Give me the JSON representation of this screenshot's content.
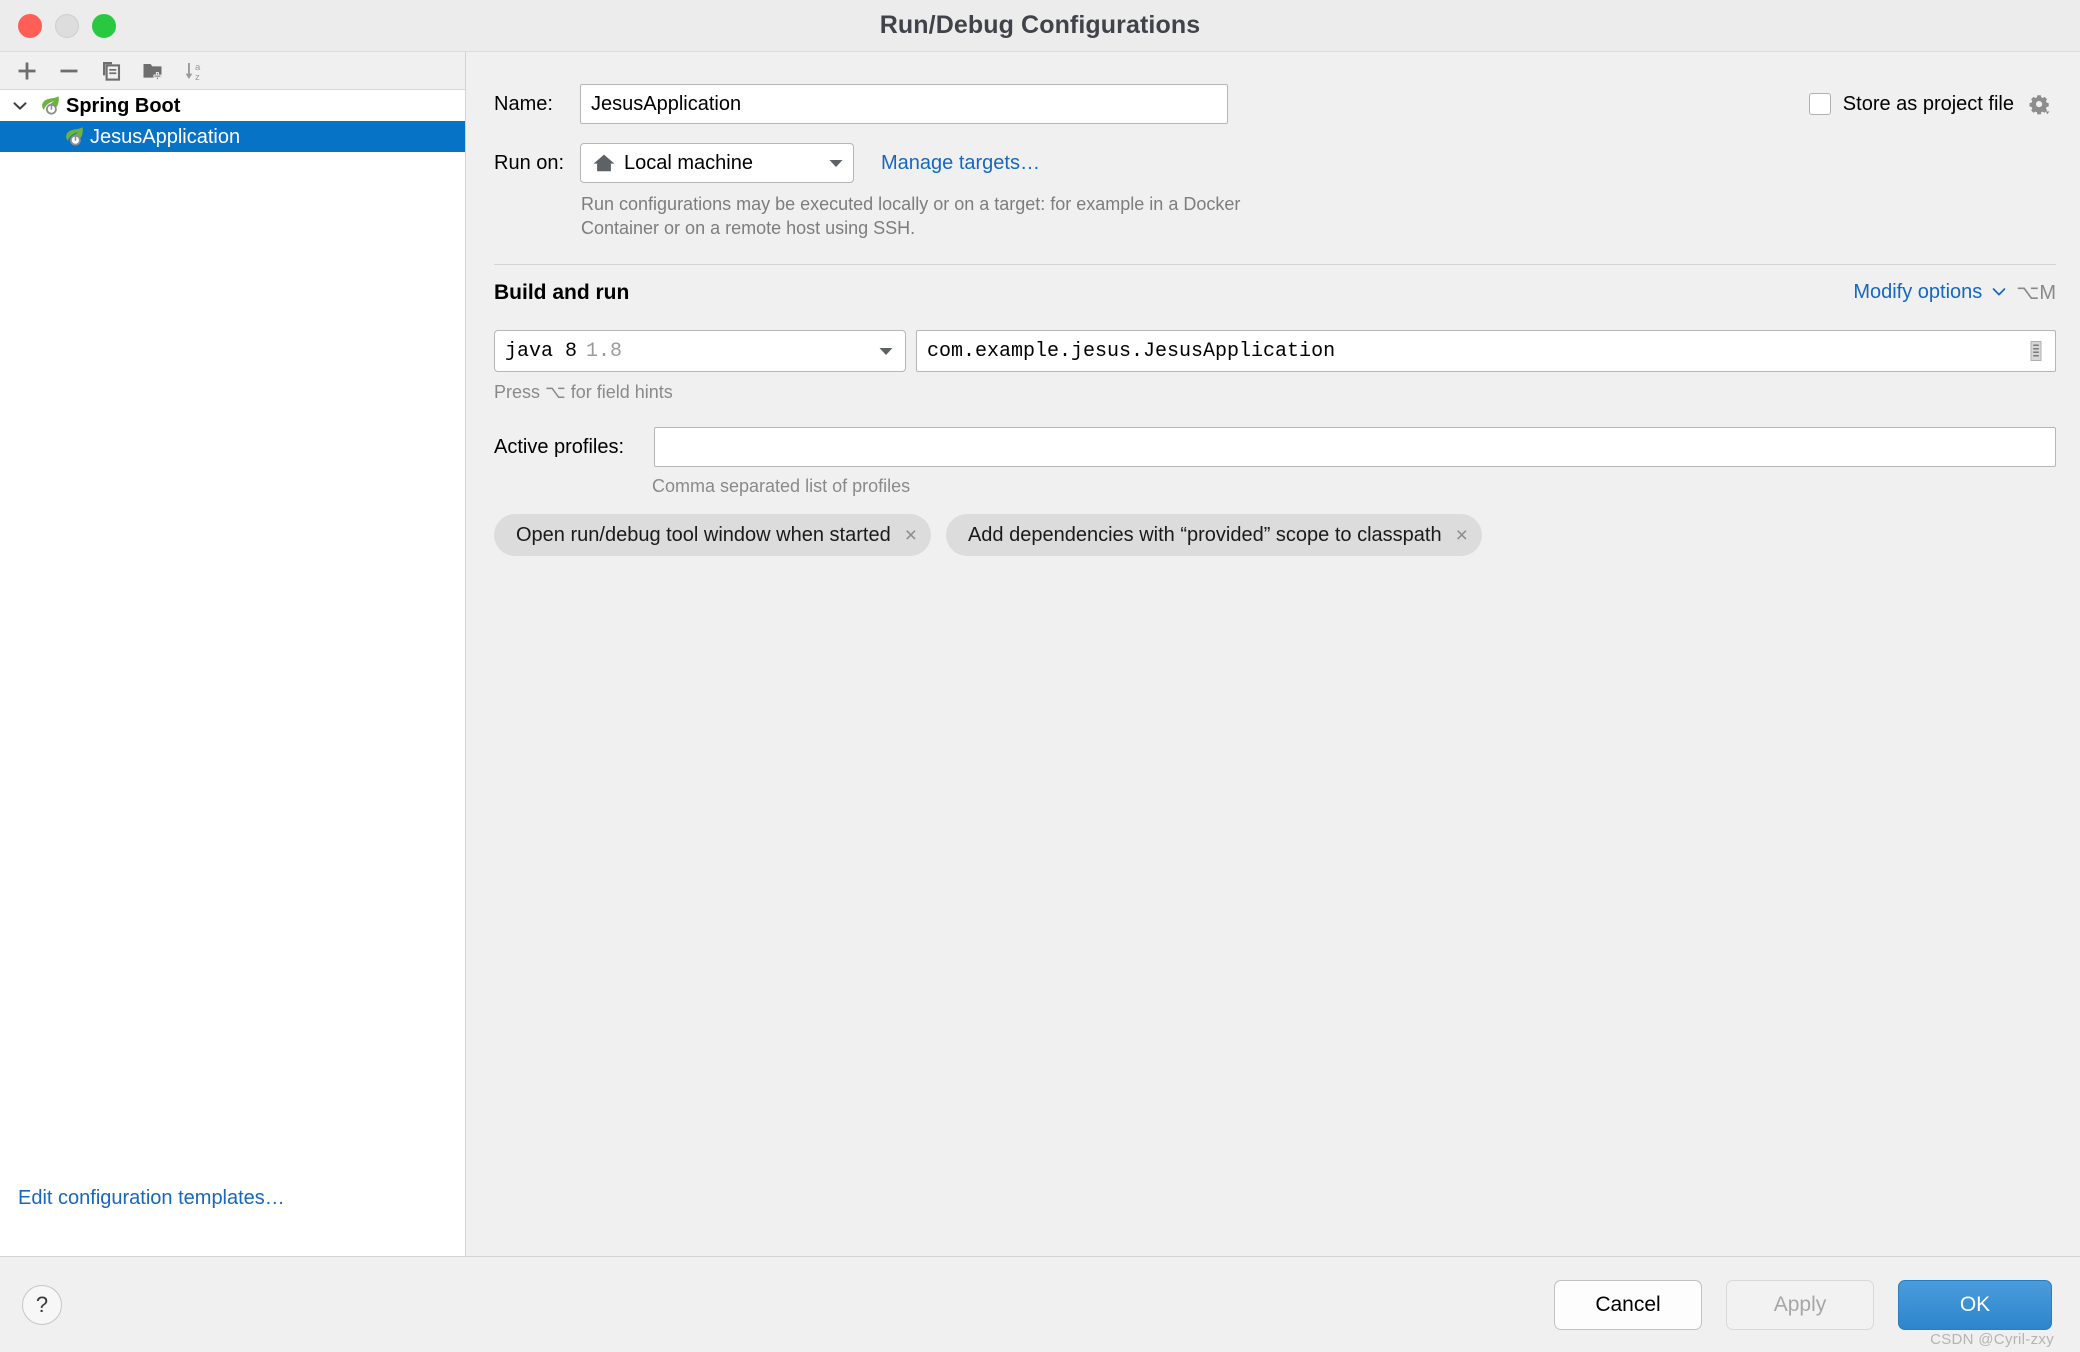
{
  "window": {
    "title": "Run/Debug Configurations",
    "traffic_lights": [
      "close",
      "minimize",
      "maximize"
    ]
  },
  "sidebar": {
    "toolbar": [
      {
        "name": "add-configuration-button",
        "icon": "plus-icon"
      },
      {
        "name": "remove-configuration-button",
        "icon": "minus-icon"
      },
      {
        "name": "copy-configuration-button",
        "icon": "copy-icon"
      },
      {
        "name": "new-folder-button",
        "icon": "folder-add-icon"
      },
      {
        "name": "sort-configurations-button",
        "icon": "sort-az-icon"
      }
    ],
    "tree": [
      {
        "label": "Spring Boot",
        "level": 0,
        "expanded": true,
        "selected": false,
        "icon": "spring-boot-icon"
      },
      {
        "label": "JesusApplication",
        "level": 1,
        "expanded": false,
        "selected": true,
        "icon": "spring-boot-icon"
      }
    ],
    "edit_templates_link": "Edit configuration templates…"
  },
  "form": {
    "name_label": "Name:",
    "name_value": "JesusApplication",
    "store_as_project_file_label": "Store as project file",
    "store_as_project_file_checked": false,
    "store_gear_icon": "gear-dropdown-icon",
    "run_on_label": "Run on:",
    "run_on_value": "Local machine",
    "run_on_icon": "home-icon",
    "manage_targets_link": "Manage targets…",
    "run_on_description": "Run configurations may be executed locally or on a target: for example in a Docker Container or on a remote host using SSH.",
    "section_title": "Build and run",
    "modify_options_label": "Modify options",
    "modify_options_shortcut": "⌥M",
    "jdk_name": "java 8",
    "jdk_version": "1.8",
    "main_class_value": "com.example.jesus.JesusApplication",
    "main_class_browse_icon": "list-browse-icon",
    "field_hints_text": "Press ⌥ for field hints",
    "active_profiles_label": "Active profiles:",
    "active_profiles_value": "",
    "active_profiles_hint": "Comma separated list of profiles",
    "chips": [
      {
        "label": "Open run/debug tool window when started",
        "close": "×"
      },
      {
        "label": "Add dependencies with “provided” scope to classpath",
        "close": "×"
      }
    ]
  },
  "footer": {
    "help_label": "?",
    "cancel_label": "Cancel",
    "apply_label": "Apply",
    "apply_disabled": true,
    "ok_label": "OK"
  },
  "watermark": "CSDN @Cyril-zxy",
  "colors": {
    "selection_blue": "#0773c7",
    "link_blue": "#1667bf",
    "ok_blue": "#2d85cc",
    "spring_green": "#6db33f",
    "chip_gray": "#dcdcdc",
    "panel_gray": "#f0f0f0"
  }
}
